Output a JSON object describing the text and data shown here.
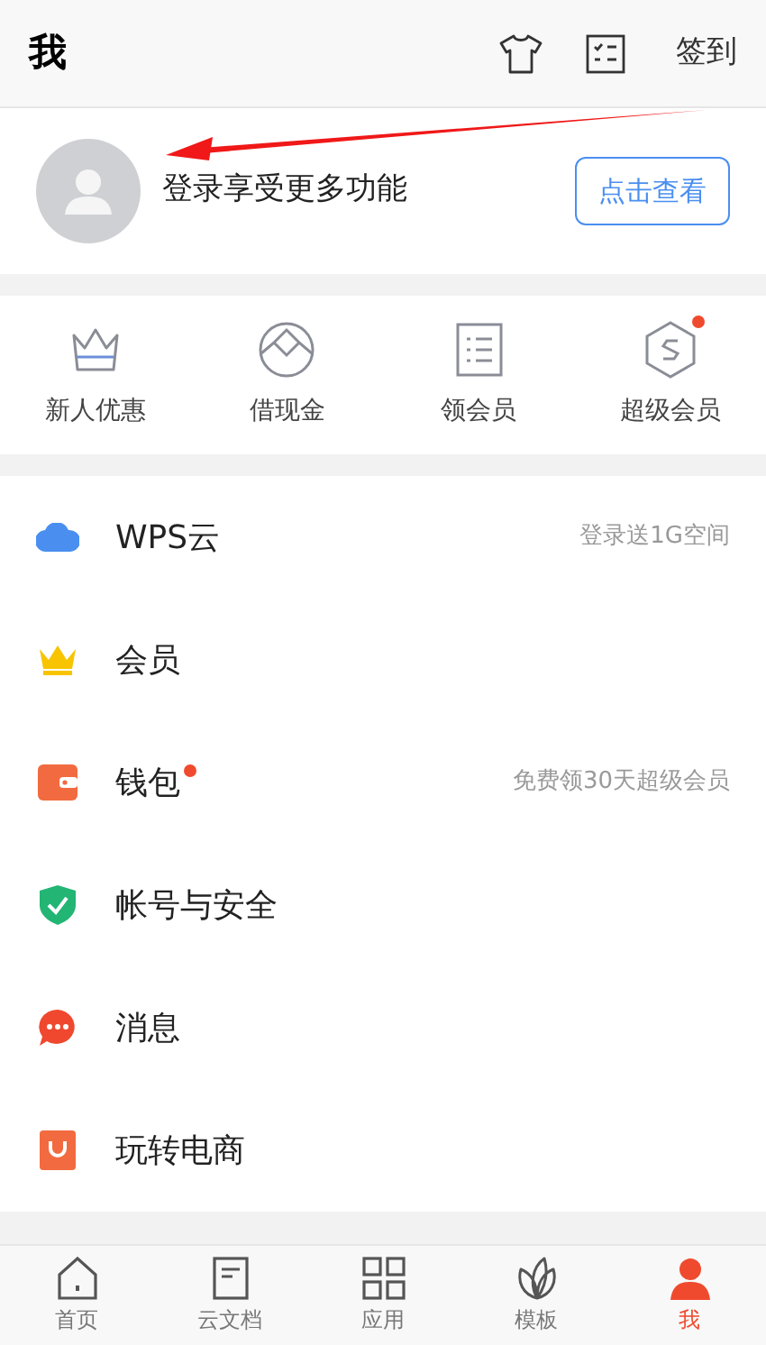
{
  "header": {
    "title": "我",
    "action": "签到"
  },
  "profile": {
    "prompt": "登录享受更多功能",
    "button": "点击查看"
  },
  "quick_links": [
    {
      "kind": "crown",
      "label": "新人优惠",
      "dot": false
    },
    {
      "kind": "coin",
      "label": "借现金",
      "dot": false
    },
    {
      "kind": "list",
      "label": "领会员",
      "dot": false
    },
    {
      "kind": "hexagon",
      "label": "超级会员",
      "dot": true
    }
  ],
  "menu": [
    {
      "kind": "cloud",
      "label": "WPS云",
      "dot": false,
      "note": "登录送1G空间"
    },
    {
      "kind": "crown",
      "label": "会员",
      "dot": false
    },
    {
      "kind": "wallet",
      "label": "钱包",
      "dot": true,
      "note": "免费领30天超级会员"
    },
    {
      "kind": "shield",
      "label": "帐号与安全",
      "dot": false
    },
    {
      "kind": "chat",
      "label": "消息",
      "dot": false
    },
    {
      "kind": "bag",
      "label": "玩转电商",
      "dot": false
    }
  ],
  "tab_bar": [
    {
      "kind": "home",
      "label": "首页",
      "selected": false
    },
    {
      "kind": "doc",
      "label": "云文档",
      "selected": false
    },
    {
      "kind": "grid",
      "label": "应用",
      "selected": false
    },
    {
      "kind": "leaf",
      "label": "模板",
      "selected": false
    },
    {
      "kind": "person",
      "label": "我",
      "selected": true
    }
  ]
}
